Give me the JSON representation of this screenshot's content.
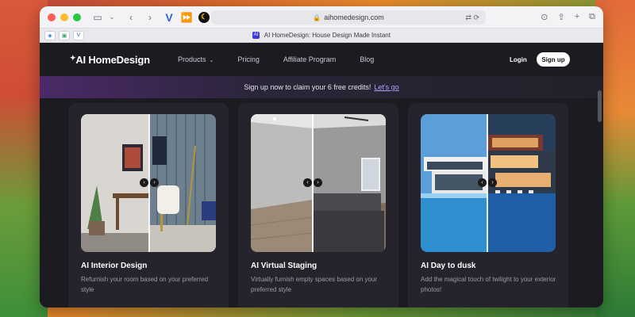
{
  "browser": {
    "url": "aihomedesign.com",
    "tab_title": "AI HomeDesign: House Design Made Instant",
    "tab_favicon_text": "AI"
  },
  "nav": {
    "logo": "AI HomeDesign",
    "logo_spark": "✦",
    "menu": [
      {
        "label": "Products"
      },
      {
        "label": "Pricing"
      },
      {
        "label": "Affiliate Program"
      },
      {
        "label": "Blog"
      }
    ],
    "login": "Login",
    "signup": "Sign up"
  },
  "banner": {
    "text": "Sign up now to claim your 6 free credits!",
    "cta": "Let's go"
  },
  "cards": [
    {
      "title": "AI Interior Design",
      "description": "Refurnish your room based on your preferred style"
    },
    {
      "title": "AI Virtual Staging",
      "description": "Virtually furnish empty spaces based on your preferred style"
    },
    {
      "title": "AI Day to dusk",
      "description": "Add the magical touch of twilight to your exterior photos!"
    }
  ],
  "colors": {
    "page_bg": "#1c1b22",
    "card_bg": "#25242c",
    "link_accent": "#a9a6ff"
  }
}
